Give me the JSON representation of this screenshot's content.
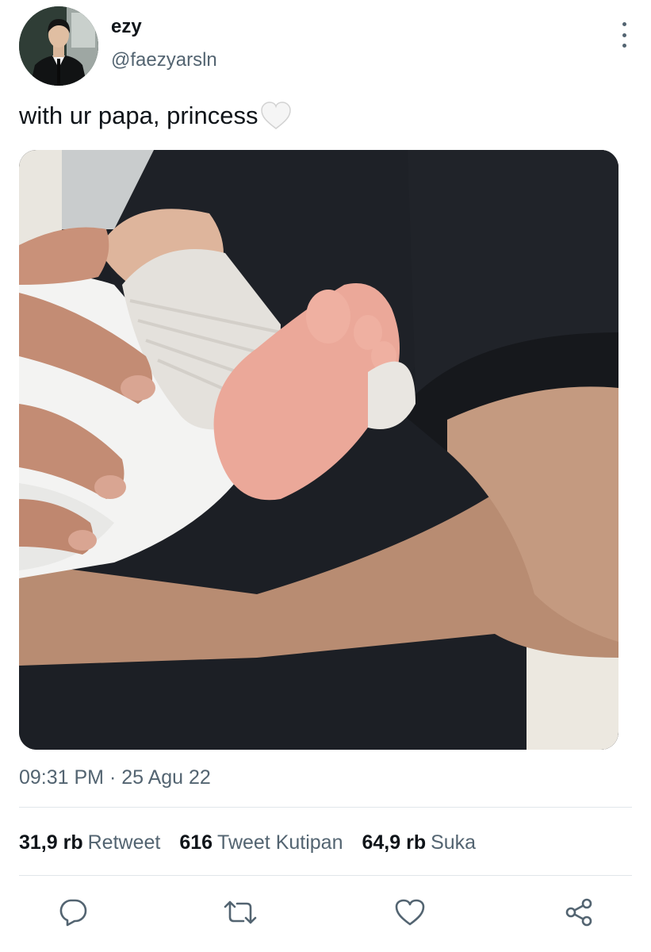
{
  "author": {
    "display_name": "ezy",
    "handle": "@faezyarsln",
    "avatar_icon": "profile-photo"
  },
  "tweet": {
    "text": "with ur papa, princess",
    "emoji": "white-heart-emoji",
    "media_description_icon": "photo-of-father-holding-baby"
  },
  "meta": {
    "timestamp": "09:31 PM · 25 Agu 22"
  },
  "stats": [
    {
      "count": "31,9 rb",
      "label": "Retweet"
    },
    {
      "count": "616",
      "label": "Tweet Kutipan"
    },
    {
      "count": "64,9 rb",
      "label": "Suka"
    }
  ],
  "actions": [
    {
      "icon": "reply-icon"
    },
    {
      "icon": "retweet-icon"
    },
    {
      "icon": "like-icon"
    },
    {
      "icon": "share-icon"
    }
  ],
  "colors": {
    "text_primary": "#0f1419",
    "text_secondary": "#536471",
    "divider": "#e1e6ea"
  }
}
